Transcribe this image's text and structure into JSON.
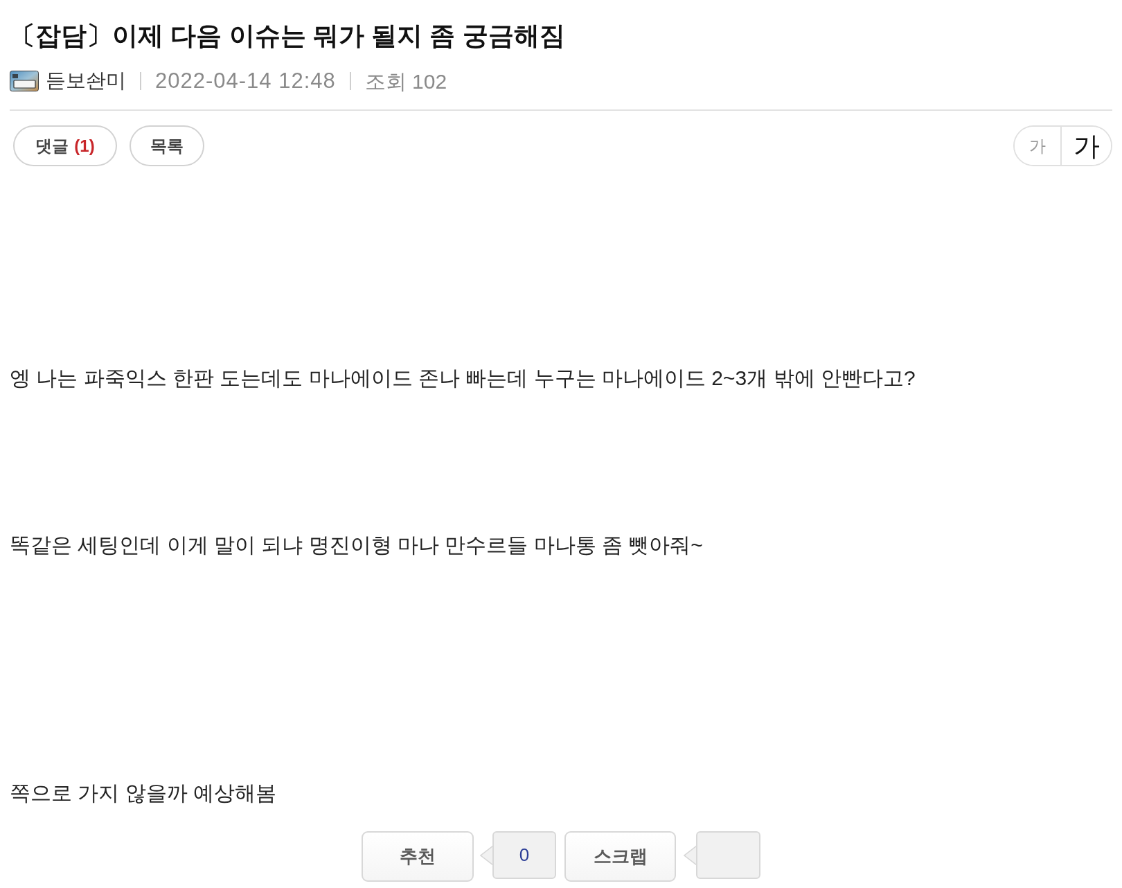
{
  "title": "〔잡담〕이제 다음 이슈는 뭐가 될지 좀 궁금해짐",
  "meta": {
    "author": "듣보솬미",
    "date": "2022-04-14 12:48",
    "views": "조회 102"
  },
  "toolbar": {
    "comment_button": {
      "label": "댓글",
      "count": "(1)"
    },
    "list_button": {
      "label": "목록"
    },
    "font_size_buttons": [
      {
        "label": "가",
        "kind": "smaller"
      },
      {
        "label": "가",
        "kind": "larger"
      }
    ]
  },
  "body": {
    "paragraphs": [
      "엥 나는 파죽익스 한판 도는데도 마나에이드 존나 빠는데 누구는 마나에이드 2~3개 밖에 안빤다고?",
      "똑같은 세팅인데 이게 말이 되냐 명진이형 마나 만수르들 마나통 좀 뺏아줘~",
      "쪽으로 가지 않을까 예상해봄"
    ]
  },
  "vote_bar": {
    "recommend_button": {
      "label": "추천"
    },
    "recommend_count": "0",
    "scrap_button": {
      "label": "스크랩"
    }
  }
}
